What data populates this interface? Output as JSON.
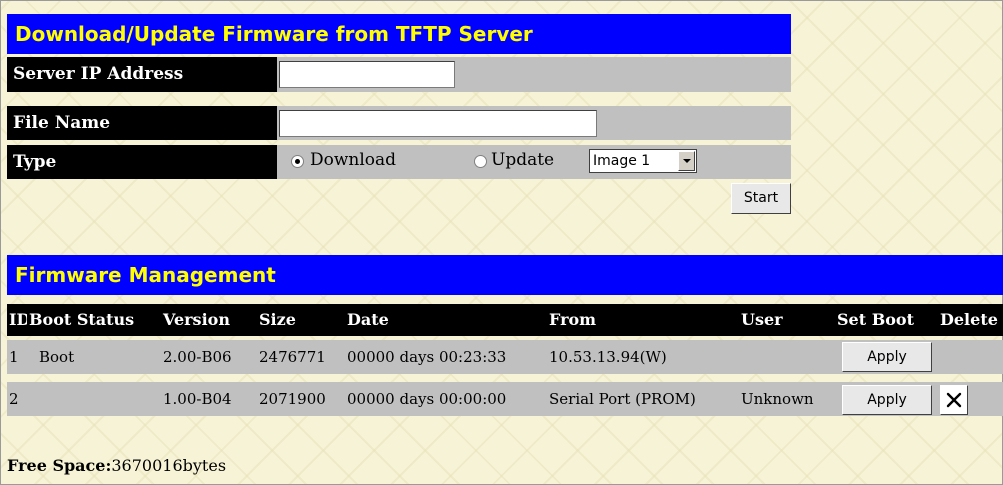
{
  "tftp": {
    "title": "Download/Update Firmware from TFTP Server",
    "server_ip_label": "Server IP Address",
    "server_ip_value": "",
    "file_name_label": "File Name",
    "file_name_value": "",
    "type_label": "Type",
    "download_label": "Download",
    "download_checked": true,
    "update_label": "Update",
    "update_checked": false,
    "image_select": {
      "selected": "Image 1"
    },
    "start_label": "Start"
  },
  "firmware": {
    "title": "Firmware Management",
    "columns": [
      "ID",
      "Boot Status",
      "Version",
      "Size",
      "Date",
      "From",
      "User",
      "Set Boot",
      "Delete"
    ],
    "rows": [
      {
        "id": "1",
        "boot_status": "Boot",
        "version": "2.00-B06",
        "size": "2476771",
        "date": "00000 days 00:23:33",
        "from": "10.53.13.94(W)",
        "user": "",
        "set_boot": "Apply",
        "delete_icon": "close-icon",
        "has_delete": false
      },
      {
        "id": "2",
        "boot_status": "",
        "version": "1.00-B04",
        "size": "2071900",
        "date": "00000 days 00:00:00",
        "from": "Serial Port (PROM)",
        "user": "Unknown",
        "set_boot": "Apply",
        "delete_icon": "close-icon",
        "has_delete": true
      }
    ]
  },
  "free_space": {
    "label": "Free Space:",
    "value": "3670016bytes"
  },
  "colors": {
    "header_bg": "#0000ff",
    "header_text": "#ffff00",
    "label_bg": "#000000",
    "cell_bg": "#c0c0c0",
    "page_bg": "#f7f3d6"
  }
}
